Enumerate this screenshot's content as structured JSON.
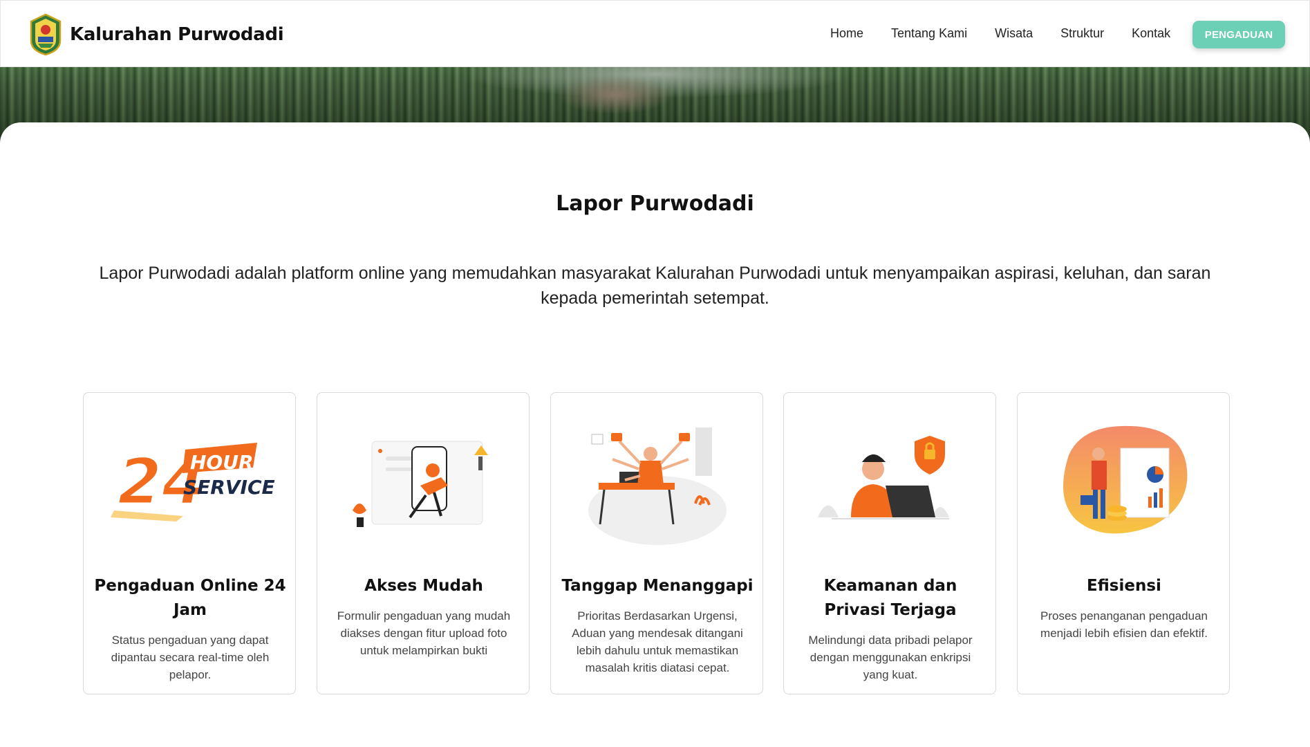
{
  "header": {
    "brand_name": "Kalurahan Purwodadi",
    "nav": [
      "Home",
      "Tentang Kami",
      "Wisata",
      "Struktur",
      "Kontak"
    ],
    "cta_label": "PENGADUAN"
  },
  "main": {
    "title": "Lapor Purwodadi",
    "intro": "Lapor Purwodadi adalah platform online yang memudahkan masyarakat Kalurahan Purwodadi untuk menyampaikan aspirasi, keluhan, dan saran kepada pemerintah setempat."
  },
  "features": [
    {
      "illustration_text": [
        "24",
        "HOUR",
        "SERVICE"
      ],
      "title": "Pengaduan Online 24 Jam",
      "description": "Status pengaduan yang dapat dipantau secara real-time oleh pelapor."
    },
    {
      "title": "Akses Mudah",
      "description": "Formulir pengaduan yang mudah diakses dengan fitur upload foto untuk melampirkan bukti"
    },
    {
      "title": "Tanggap Menanggapi",
      "description": "Prioritas Berdasarkan Urgensi, Aduan yang mendesak ditangani lebih dahulu untuk memastikan masalah kritis diatasi cepat."
    },
    {
      "title": "Keamanan dan Privasi Terjaga",
      "description": "Melindungi data pribadi pelapor dengan menggunakan enkripsi yang kuat."
    },
    {
      "title": "Efisiensi",
      "description": "Proses penanganan pengaduan menjadi lebih efisien dan efektif."
    }
  ],
  "colors": {
    "accent": "#6cd0b6",
    "illustration_orange": "#f26b1d",
    "illustration_yellow": "#f7b52b"
  },
  "icons": [
    "village-emblem-logo",
    "24-hour-service-icon",
    "mobile-access-illustration",
    "multitasking-responder-illustration",
    "security-shield-illustration",
    "efficiency-report-illustration"
  ]
}
